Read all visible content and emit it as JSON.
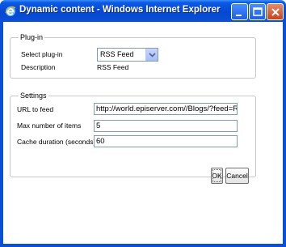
{
  "window": {
    "title": "Dynamic content - Windows Internet Explorer",
    "app_icon": "internet-explorer-icon",
    "controls": [
      "minimize-icon",
      "maximize-icon",
      "close-icon"
    ],
    "title_color": "#0a4fd6"
  },
  "plugin_group": {
    "legend": "Plug-in",
    "select_label": "Select plug-in",
    "select_value": "RSS Feed",
    "description_label": "Description",
    "description_value": "RSS Feed"
  },
  "settings_group": {
    "legend": "Settings",
    "url_label": "URL to feed",
    "url_value": "http://world.episerver.com//Blogs/?feed=R",
    "max_items_label": "Max number of items",
    "max_items_value": "5",
    "cache_label": "Cache duration (seconds)",
    "cache_value": "60"
  },
  "buttons": {
    "ok": "OK",
    "cancel": "Cancel"
  }
}
